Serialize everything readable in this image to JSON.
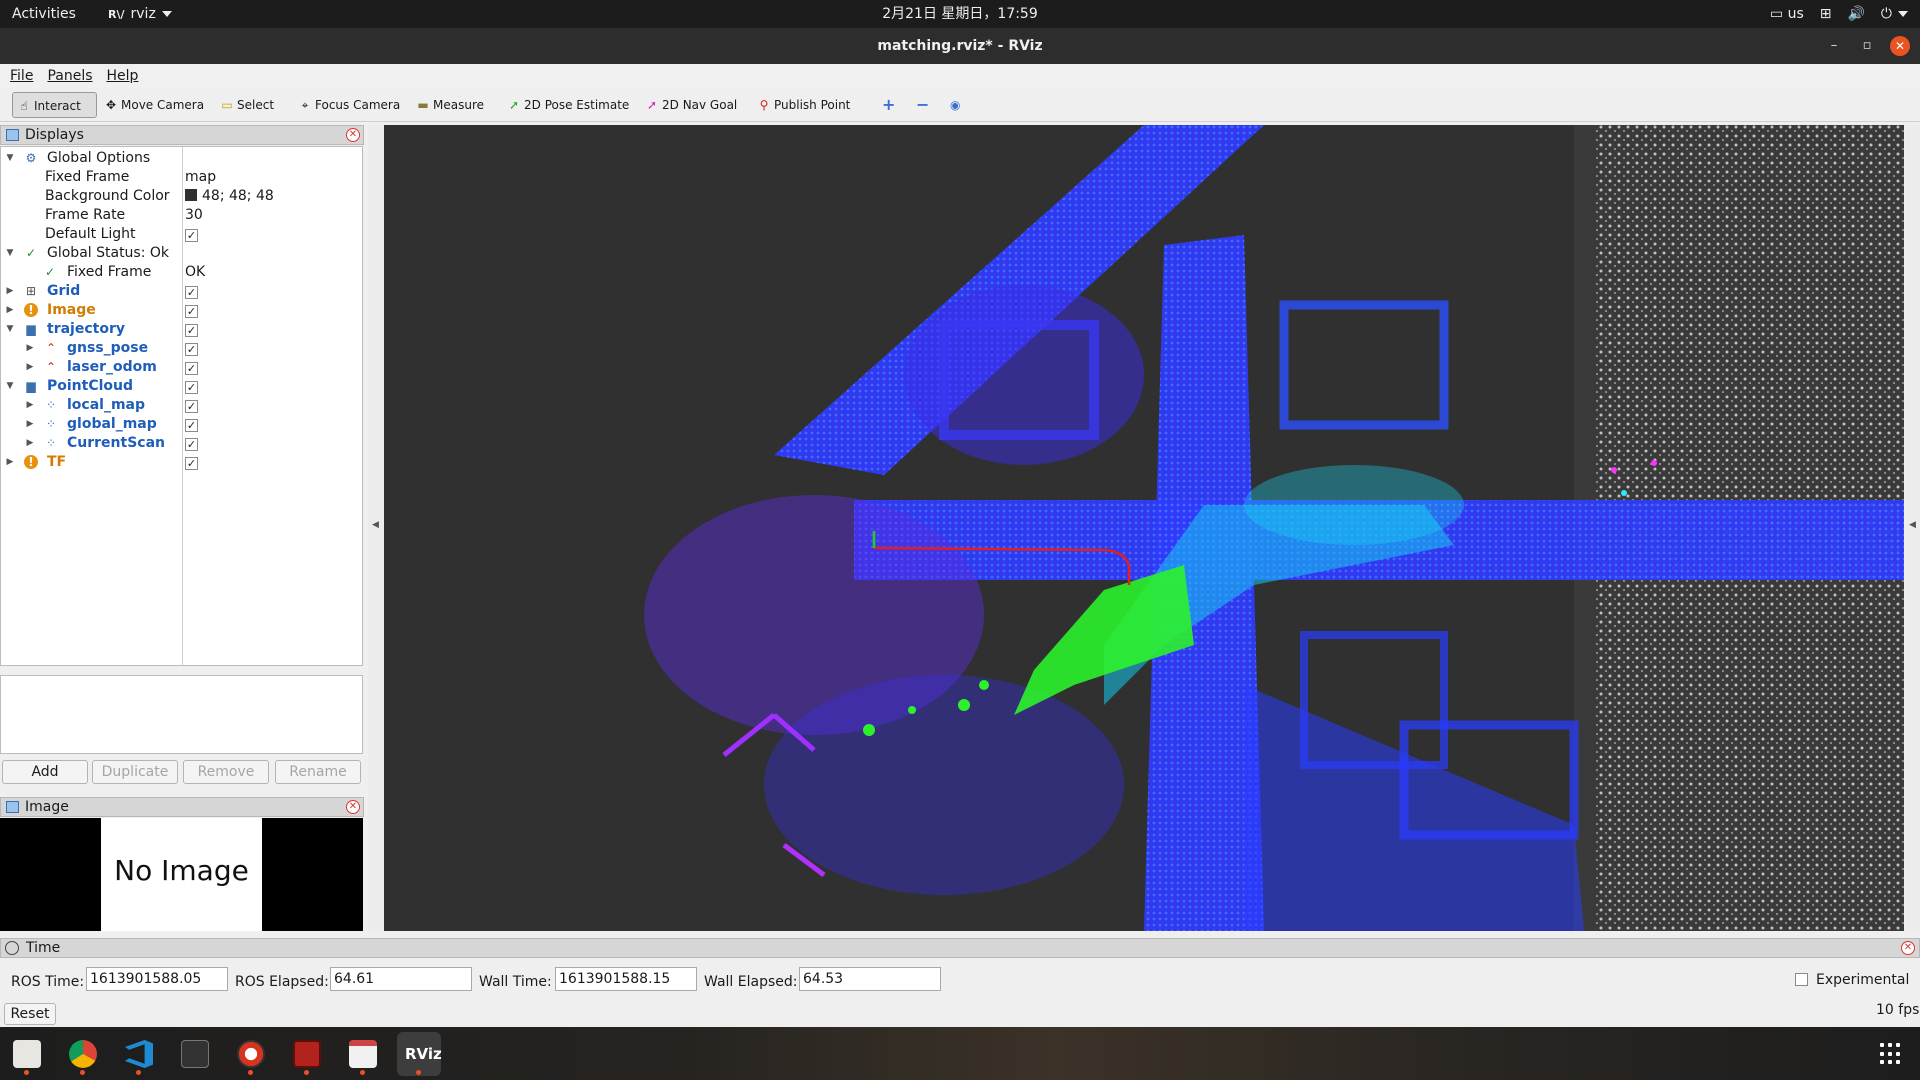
{
  "topbar": {
    "activities": "Activities",
    "app_name": "rviz",
    "app_logo": "R\\/",
    "clock": "2月21日 星期日，17:59",
    "keyboard_layout": "us",
    "tray_icons": [
      "keyboard-icon",
      "network-icon",
      "volume-icon",
      "power-icon"
    ]
  },
  "window": {
    "title": "matching.rviz* - RViz",
    "minimize": "–",
    "maximize": "▫",
    "close": "✕"
  },
  "menu": {
    "file": "File",
    "panels": "Panels",
    "help": "Help"
  },
  "toolbar": {
    "interact": "Interact",
    "move_camera": "Move Camera",
    "select": "Select",
    "focus_camera": "Focus Camera",
    "measure": "Measure",
    "pose_estimate": "2D Pose Estimate",
    "nav_goal": "2D Nav Goal",
    "publish_point": "Publish Point",
    "plus": "+",
    "minus": "−",
    "eye": "◉"
  },
  "displays_panel": {
    "title": "Displays",
    "global_options": {
      "label": "Global Options",
      "fixed_frame_label": "Fixed Frame",
      "fixed_frame_value": "map",
      "background_color_label": "Background Color",
      "background_color_value": "48; 48; 48",
      "background_color_hex": "#303030",
      "frame_rate_label": "Frame Rate",
      "frame_rate_value": "30",
      "default_light_label": "Default Light",
      "default_light_checked": true
    },
    "global_status": {
      "label": "Global Status: Ok",
      "fixed_frame_label": "Fixed Frame",
      "fixed_frame_value": "OK"
    },
    "items": [
      {
        "label": "Grid",
        "icon": "grid-icon",
        "checked": true
      },
      {
        "label": "Image",
        "icon": "warning-icon",
        "checked": true
      },
      {
        "label": "trajectory",
        "icon": "folder-icon",
        "checked": true
      },
      {
        "label": "gnss_pose",
        "icon": "path-icon",
        "checked": true
      },
      {
        "label": "laser_odom",
        "icon": "path-icon",
        "checked": true
      },
      {
        "label": "PointCloud",
        "icon": "folder-icon",
        "checked": true
      },
      {
        "label": "local_map",
        "icon": "pointcloud-icon",
        "checked": true
      },
      {
        "label": "global_map",
        "icon": "pointcloud-icon",
        "checked": true
      },
      {
        "label": "CurrentScan",
        "icon": "pointcloud-icon",
        "checked": true
      },
      {
        "label": "TF",
        "icon": "warning-icon",
        "checked": true
      }
    ],
    "buttons": {
      "add": "Add",
      "duplicate": "Duplicate",
      "remove": "Remove",
      "rename": "Rename"
    }
  },
  "image_panel": {
    "title": "Image",
    "placeholder": "No Image"
  },
  "time_panel": {
    "title": "Time",
    "ros_time_label": "ROS Time:",
    "ros_time_value": "1613901588.05",
    "ros_elapsed_label": "ROS Elapsed:",
    "ros_elapsed_value": "64.61",
    "wall_time_label": "Wall Time:",
    "wall_time_value": "1613901588.15",
    "wall_elapsed_label": "Wall Elapsed:",
    "wall_elapsed_value": "64.53",
    "experimental_label": "Experimental",
    "experimental_checked": false,
    "reset_label": "Reset",
    "fps": "10 fps"
  },
  "dock": {
    "apps": [
      "files-icon",
      "chrome-icon",
      "vscode-icon",
      "system-monitor-icon",
      "ubuntu-software-icon",
      "terminal-icon",
      "text-editor-icon",
      "rviz-icon"
    ],
    "rviz_label": "RViz"
  },
  "colors": {
    "accent": "#e95420",
    "display_item_blue": "#1f5dba",
    "warning_orange": "#d27c00",
    "cloud_blue": "#2a3cff",
    "cloud_violet": "#7a2cff",
    "cloud_cyan": "#18d8f0",
    "cloud_green": "#2cf22c",
    "cloud_gray": "#c8c8c8",
    "trajectory_red": "#e02020"
  }
}
